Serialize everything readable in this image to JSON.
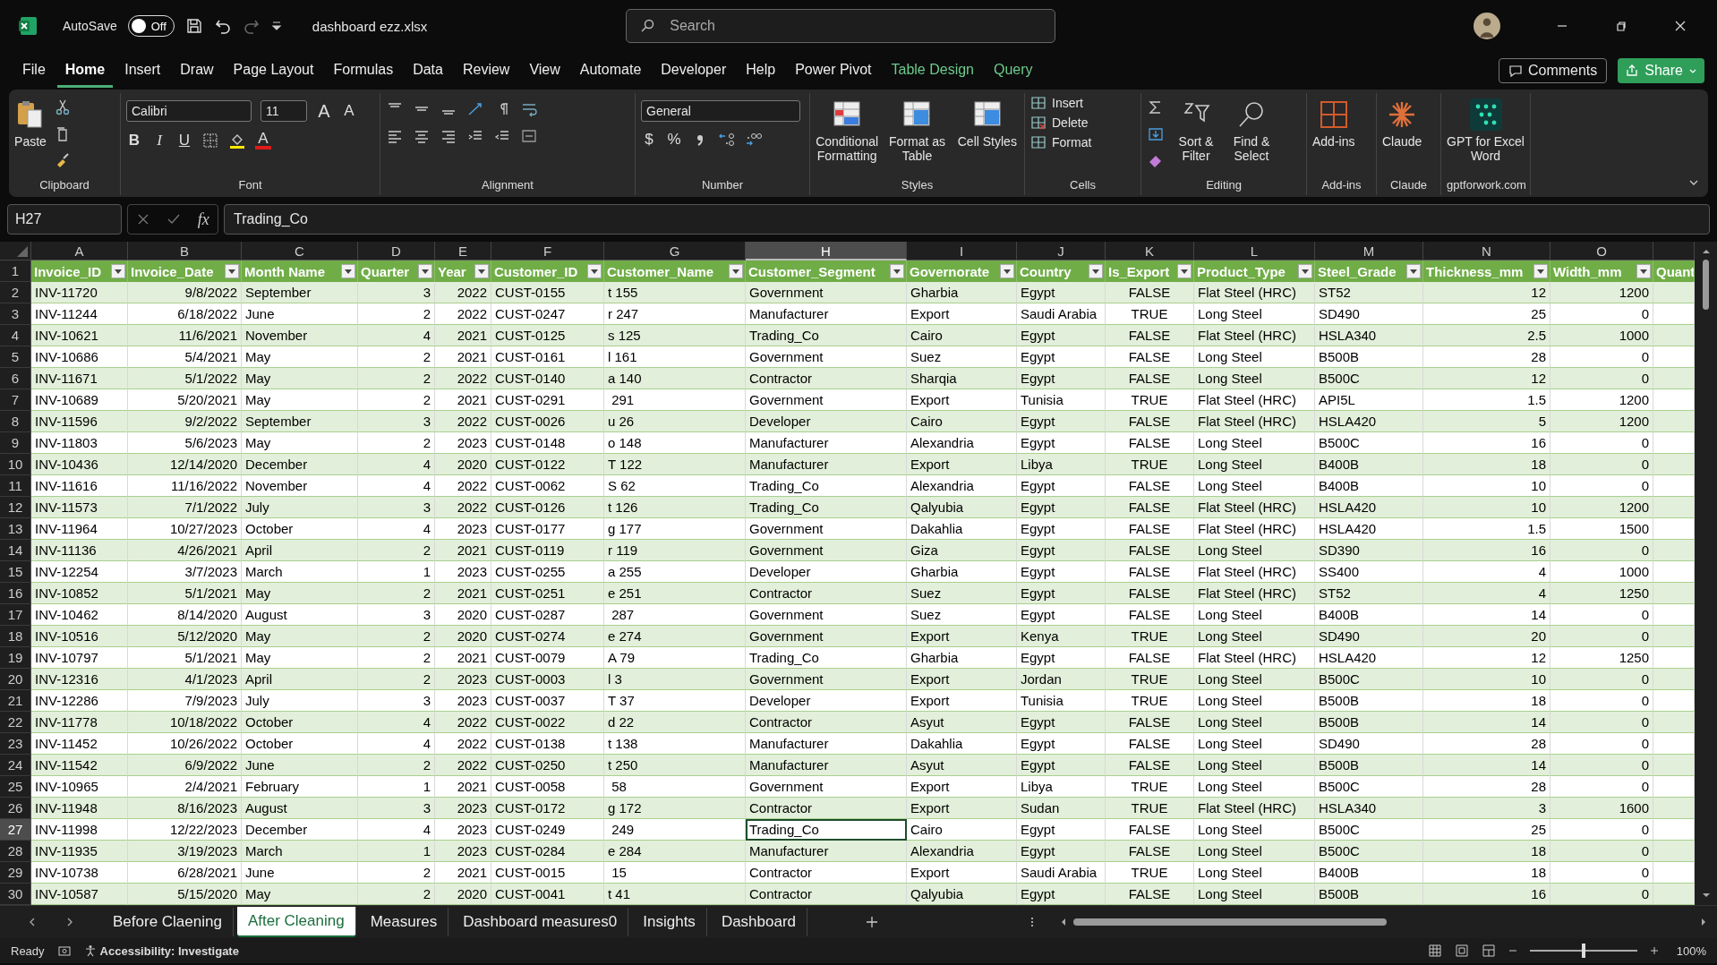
{
  "title_bar": {
    "autosave_label": "AutoSave",
    "autosave": {
      "on": false,
      "label": "Off"
    },
    "file_name": "dashboard ezz.xlsx",
    "search": {
      "placeholder": "Search"
    }
  },
  "menu_tabs": [
    {
      "label": "File",
      "selected": false,
      "kind": "normal"
    },
    {
      "label": "Home",
      "selected": true,
      "kind": "normal"
    },
    {
      "label": "Insert",
      "selected": false,
      "kind": "normal"
    },
    {
      "label": "Draw",
      "selected": false,
      "kind": "normal"
    },
    {
      "label": "Page Layout",
      "selected": false,
      "kind": "normal"
    },
    {
      "label": "Formulas",
      "selected": false,
      "kind": "normal"
    },
    {
      "label": "Data",
      "selected": false,
      "kind": "normal"
    },
    {
      "label": "Review",
      "selected": false,
      "kind": "normal"
    },
    {
      "label": "View",
      "selected": false,
      "kind": "normal"
    },
    {
      "label": "Automate",
      "selected": false,
      "kind": "normal"
    },
    {
      "label": "Developer",
      "selected": false,
      "kind": "normal"
    },
    {
      "label": "Help",
      "selected": false,
      "kind": "normal"
    },
    {
      "label": "Power Pivot",
      "selected": false,
      "kind": "normal"
    },
    {
      "label": "Table Design",
      "selected": false,
      "kind": "contextual"
    },
    {
      "label": "Query",
      "selected": false,
      "kind": "contextual"
    }
  ],
  "comments_button": "Comments",
  "share_button": "Share",
  "ribbon": {
    "clipboard": {
      "paste": "Paste",
      "label": "Clipboard"
    },
    "font": {
      "family": "Calibri",
      "size": "11",
      "grow": "A",
      "shrink": "A",
      "bold": "B",
      "italic": "I",
      "underline": "U",
      "color_glyph": "A",
      "label": "Font"
    },
    "alignment": {
      "label": "Alignment"
    },
    "number": {
      "format": "General",
      "currency": "$",
      "percent": "%",
      "label": "Number"
    },
    "styles": {
      "buttons": [
        "Conditional Formatting",
        "Format as Table",
        "Cell Styles"
      ],
      "label": "Styles"
    },
    "cells": {
      "buttons": [
        "Insert",
        "Delete",
        "Format"
      ],
      "label": "Cells"
    },
    "editing": {
      "buttons": [
        "Sort & Filter",
        "Find & Select"
      ],
      "label": "Editing"
    },
    "addins": {
      "button": "Add-ins",
      "label": "Add-ins"
    },
    "claude": {
      "button": "Claude",
      "label": "Claude"
    },
    "gpt": {
      "button": "GPT for Excel Word",
      "label": "gptforwork.com"
    }
  },
  "formula_bar": {
    "name_box": "H27",
    "fx": "fx",
    "value": "Trading_Co"
  },
  "header_row_number": "1",
  "columns": [
    {
      "letter": "A",
      "header": "Invoice_ID",
      "kind": "text",
      "selected": false
    },
    {
      "letter": "B",
      "header": "Invoice_Date",
      "kind": "number",
      "selected": false
    },
    {
      "letter": "C",
      "header": "Month Name",
      "kind": "text",
      "selected": false
    },
    {
      "letter": "D",
      "header": "Quarter",
      "kind": "number",
      "selected": false
    },
    {
      "letter": "E",
      "header": "Year",
      "kind": "number",
      "selected": false
    },
    {
      "letter": "F",
      "header": "Customer_ID",
      "kind": "text",
      "selected": false
    },
    {
      "letter": "G",
      "header": "Customer_Name",
      "kind": "text",
      "selected": false
    },
    {
      "letter": "H",
      "header": "Customer_Segment",
      "kind": "text",
      "selected": true
    },
    {
      "letter": "I",
      "header": "Governorate",
      "kind": "text",
      "selected": false
    },
    {
      "letter": "J",
      "header": "Country",
      "kind": "text",
      "selected": false
    },
    {
      "letter": "K",
      "header": "Is_Export",
      "kind": "bool",
      "selected": false
    },
    {
      "letter": "L",
      "header": "Product_Type",
      "kind": "text",
      "selected": false
    },
    {
      "letter": "M",
      "header": "Steel_Grade",
      "kind": "text",
      "selected": false
    },
    {
      "letter": "N",
      "header": "Thickness_mm",
      "kind": "number",
      "selected": false
    },
    {
      "letter": "O",
      "header": "Width_mm",
      "kind": "number",
      "selected": false
    },
    {
      "header": "Quant",
      "kind": "text",
      "selected": false
    }
  ],
  "rows": [
    {
      "number": "2",
      "selected": false,
      "cells": [
        "INV-11720",
        "9/8/2022",
        "September",
        "3",
        "2022",
        "CUST-0155",
        "t 155",
        "Government",
        "Gharbia",
        "Egypt",
        "FALSE",
        "Flat Steel (HRC)",
        "ST52",
        "12",
        "1200"
      ]
    },
    {
      "number": "3",
      "selected": false,
      "cells": [
        "INV-11244",
        "6/18/2022",
        "June",
        "2",
        "2022",
        "CUST-0247",
        "r 247",
        "Manufacturer",
        "Export",
        "Saudi Arabia",
        "TRUE",
        "Long Steel",
        "SD490",
        "25",
        "0"
      ]
    },
    {
      "number": "4",
      "selected": false,
      "cells": [
        "INV-10621",
        "11/6/2021",
        "November",
        "4",
        "2021",
        "CUST-0125",
        "s 125",
        "Trading_Co",
        "Cairo",
        "Egypt",
        "FALSE",
        "Flat Steel (HRC)",
        "HSLA340",
        "2.5",
        "1000"
      ]
    },
    {
      "number": "5",
      "selected": false,
      "cells": [
        "INV-10686",
        "5/4/2021",
        "May",
        "2",
        "2021",
        "CUST-0161",
        "l 161",
        "Government",
        "Suez",
        "Egypt",
        "FALSE",
        "Long Steel",
        "B500B",
        "28",
        "0"
      ]
    },
    {
      "number": "6",
      "selected": false,
      "cells": [
        "INV-11671",
        "5/1/2022",
        "May",
        "2",
        "2022",
        "CUST-0140",
        "a 140",
        "Contractor",
        "Sharqia",
        "Egypt",
        "FALSE",
        "Long Steel",
        "B500C",
        "12",
        "0"
      ]
    },
    {
      "number": "7",
      "selected": false,
      "cells": [
        "INV-10689",
        "5/20/2021",
        "May",
        "2",
        "2021",
        "CUST-0291",
        " 291",
        "Government",
        "Export",
        "Tunisia",
        "TRUE",
        "Flat Steel (HRC)",
        "API5L",
        "1.5",
        "1200"
      ]
    },
    {
      "number": "8",
      "selected": false,
      "cells": [
        "INV-11596",
        "9/2/2022",
        "September",
        "3",
        "2022",
        "CUST-0026",
        "u 26",
        "Developer",
        "Cairo",
        "Egypt",
        "FALSE",
        "Flat Steel (HRC)",
        "HSLA420",
        "5",
        "1200"
      ]
    },
    {
      "number": "9",
      "selected": false,
      "cells": [
        "INV-11803",
        "5/6/2023",
        "May",
        "2",
        "2023",
        "CUST-0148",
        "o 148",
        "Manufacturer",
        "Alexandria",
        "Egypt",
        "FALSE",
        "Long Steel",
        "B500C",
        "16",
        "0"
      ]
    },
    {
      "number": "10",
      "selected": false,
      "cells": [
        "INV-10436",
        "12/14/2020",
        "December",
        "4",
        "2020",
        "CUST-0122",
        "T 122",
        "Manufacturer",
        "Export",
        "Libya",
        "TRUE",
        "Long Steel",
        "B400B",
        "18",
        "0"
      ]
    },
    {
      "number": "11",
      "selected": false,
      "cells": [
        "INV-11616",
        "11/16/2022",
        "November",
        "4",
        "2022",
        "CUST-0062",
        "S 62",
        "Trading_Co",
        "Alexandria",
        "Egypt",
        "FALSE",
        "Long Steel",
        "B400B",
        "10",
        "0"
      ]
    },
    {
      "number": "12",
      "selected": false,
      "cells": [
        "INV-11573",
        "7/1/2022",
        "July",
        "3",
        "2022",
        "CUST-0126",
        "t 126",
        "Trading_Co",
        "Qalyubia",
        "Egypt",
        "FALSE",
        "Flat Steel (HRC)",
        "HSLA420",
        "10",
        "1200"
      ]
    },
    {
      "number": "13",
      "selected": false,
      "cells": [
        "INV-11964",
        "10/27/2023",
        "October",
        "4",
        "2023",
        "CUST-0177",
        "g 177",
        "Government",
        "Dakahlia",
        "Egypt",
        "FALSE",
        "Flat Steel (HRC)",
        "HSLA420",
        "1.5",
        "1500"
      ]
    },
    {
      "number": "14",
      "selected": false,
      "cells": [
        "INV-11136",
        "4/26/2021",
        "April",
        "2",
        "2021",
        "CUST-0119",
        "r 119",
        "Government",
        "Giza",
        "Egypt",
        "FALSE",
        "Long Steel",
        "SD390",
        "16",
        "0"
      ]
    },
    {
      "number": "15",
      "selected": false,
      "cells": [
        "INV-12254",
        "3/7/2023",
        "March",
        "1",
        "2023",
        "CUST-0255",
        "a 255",
        "Developer",
        "Gharbia",
        "Egypt",
        "FALSE",
        "Flat Steel (HRC)",
        "SS400",
        "4",
        "1000"
      ]
    },
    {
      "number": "16",
      "selected": false,
      "cells": [
        "INV-10852",
        "5/1/2021",
        "May",
        "2",
        "2021",
        "CUST-0251",
        "e 251",
        "Contractor",
        "Suez",
        "Egypt",
        "FALSE",
        "Flat Steel (HRC)",
        "ST52",
        "4",
        "1250"
      ]
    },
    {
      "number": "17",
      "selected": false,
      "cells": [
        "INV-10462",
        "8/14/2020",
        "August",
        "3",
        "2020",
        "CUST-0287",
        " 287",
        "Government",
        "Suez",
        "Egypt",
        "FALSE",
        "Long Steel",
        "B400B",
        "14",
        "0"
      ]
    },
    {
      "number": "18",
      "selected": false,
      "cells": [
        "INV-10516",
        "5/12/2020",
        "May",
        "2",
        "2020",
        "CUST-0274",
        "e 274",
        "Government",
        "Export",
        "Kenya",
        "TRUE",
        "Long Steel",
        "SD490",
        "20",
        "0"
      ]
    },
    {
      "number": "19",
      "selected": false,
      "cells": [
        "INV-10797",
        "5/1/2021",
        "May",
        "2",
        "2021",
        "CUST-0079",
        "A 79",
        "Trading_Co",
        "Gharbia",
        "Egypt",
        "FALSE",
        "Flat Steel (HRC)",
        "HSLA420",
        "12",
        "1250"
      ]
    },
    {
      "number": "20",
      "selected": false,
      "cells": [
        "INV-12316",
        "4/1/2023",
        "April",
        "2",
        "2023",
        "CUST-0003",
        "l 3",
        "Government",
        "Export",
        "Jordan",
        "TRUE",
        "Long Steel",
        "B500C",
        "10",
        "0"
      ]
    },
    {
      "number": "21",
      "selected": false,
      "cells": [
        "INV-12286",
        "7/9/2023",
        "July",
        "3",
        "2023",
        "CUST-0037",
        "T 37",
        "Developer",
        "Export",
        "Tunisia",
        "TRUE",
        "Long Steel",
        "B500B",
        "18",
        "0"
      ]
    },
    {
      "number": "22",
      "selected": false,
      "cells": [
        "INV-11778",
        "10/18/2022",
        "October",
        "4",
        "2022",
        "CUST-0022",
        "d 22",
        "Contractor",
        "Asyut",
        "Egypt",
        "FALSE",
        "Long Steel",
        "B500B",
        "14",
        "0"
      ]
    },
    {
      "number": "23",
      "selected": false,
      "cells": [
        "INV-11452",
        "10/26/2022",
        "October",
        "4",
        "2022",
        "CUST-0138",
        "t 138",
        "Manufacturer",
        "Dakahlia",
        "Egypt",
        "FALSE",
        "Long Steel",
        "SD490",
        "28",
        "0"
      ]
    },
    {
      "number": "24",
      "selected": false,
      "cells": [
        "INV-11542",
        "6/9/2022",
        "June",
        "2",
        "2022",
        "CUST-0250",
        "t 250",
        "Manufacturer",
        "Asyut",
        "Egypt",
        "FALSE",
        "Long Steel",
        "B500B",
        "14",
        "0"
      ]
    },
    {
      "number": "25",
      "selected": false,
      "cells": [
        "INV-10965",
        "2/4/2021",
        "February",
        "1",
        "2021",
        "CUST-0058",
        " 58",
        "Government",
        "Export",
        "Libya",
        "TRUE",
        "Long Steel",
        "B500C",
        "28",
        "0"
      ]
    },
    {
      "number": "26",
      "selected": false,
      "cells": [
        "INV-11948",
        "8/16/2023",
        "August",
        "3",
        "2023",
        "CUST-0172",
        "g 172",
        "Contractor",
        "Export",
        "Sudan",
        "TRUE",
        "Flat Steel (HRC)",
        "HSLA340",
        "3",
        "1600"
      ]
    },
    {
      "number": "27",
      "selected": true,
      "cells": [
        "INV-11998",
        "12/22/2023",
        "December",
        "4",
        "2023",
        "CUST-0249",
        " 249",
        "Trading_Co",
        "Cairo",
        "Egypt",
        "FALSE",
        "Long Steel",
        "B500C",
        "25",
        "0"
      ]
    },
    {
      "number": "28",
      "selected": false,
      "cells": [
        "INV-11935",
        "3/19/2023",
        "March",
        "1",
        "2023",
        "CUST-0284",
        "e 284",
        "Manufacturer",
        "Alexandria",
        "Egypt",
        "FALSE",
        "Long Steel",
        "B500C",
        "18",
        "0"
      ]
    },
    {
      "number": "29",
      "selected": false,
      "cells": [
        "INV-10738",
        "6/28/2021",
        "June",
        "2",
        "2021",
        "CUST-0015",
        " 15",
        "Contractor",
        "Export",
        "Saudi Arabia",
        "TRUE",
        "Long Steel",
        "B400B",
        "18",
        "0"
      ]
    },
    {
      "number": "30",
      "selected": false,
      "cells": [
        "INV-10587",
        "5/15/2020",
        "May",
        "2",
        "2020",
        "CUST-0041",
        "t 41",
        "Contractor",
        "Qalyubia",
        "Egypt",
        "FALSE",
        "Long Steel",
        "B500B",
        "16",
        "0"
      ]
    }
  ],
  "sheet_tabs": [
    {
      "label": "Before Claening",
      "selected": false
    },
    {
      "label": "After Cleaning",
      "selected": true
    },
    {
      "label": "Measures",
      "selected": false
    },
    {
      "label": "Dashboard measures0",
      "selected": false
    },
    {
      "label": "Insights",
      "selected": false
    },
    {
      "label": "Dashboard",
      "selected": false
    }
  ],
  "status_bar": {
    "mode": "Ready",
    "accessibility": "Accessibility: Investigate",
    "zoom": "100%"
  }
}
